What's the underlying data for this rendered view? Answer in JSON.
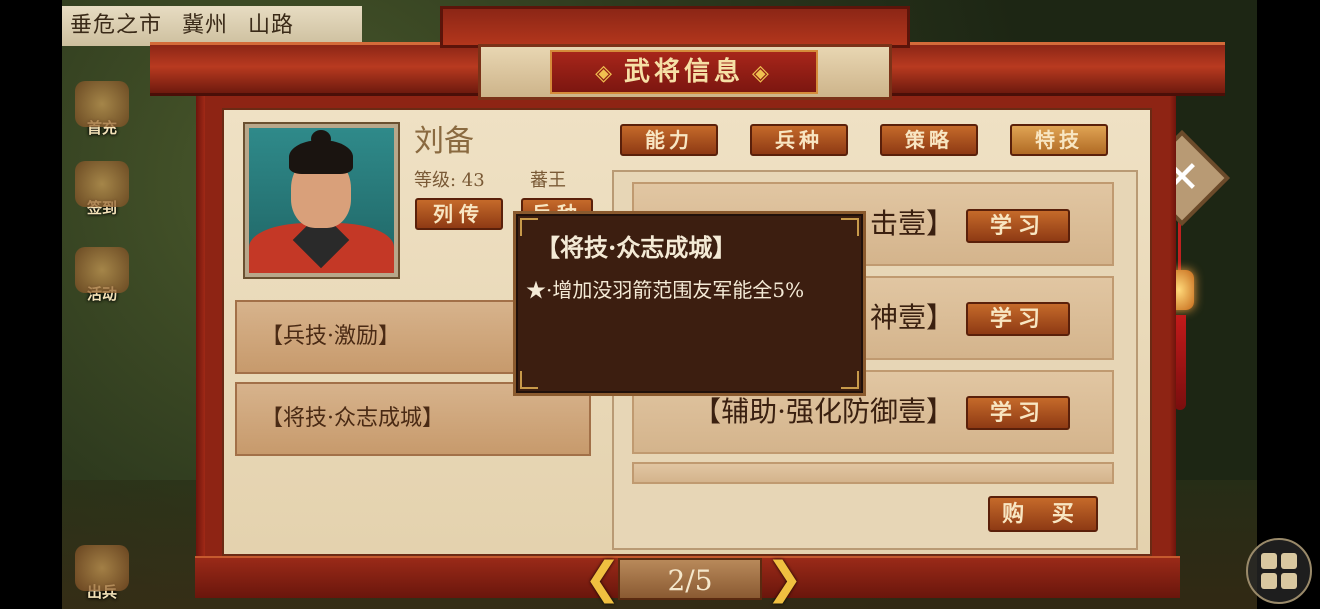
{
  "location": {
    "parts": [
      "垂危之市",
      "冀州",
      "山路"
    ]
  },
  "side_menu": [
    {
      "label": "首充",
      "icon": "treasure-chest-icon"
    },
    {
      "label": "签到",
      "icon": "scroll-brush-icon"
    },
    {
      "label": "活动",
      "icon": "event-icon"
    },
    {
      "label": "出兵",
      "icon": "war-drum-icon"
    }
  ],
  "dialog": {
    "title": "武将信息"
  },
  "hero": {
    "name": "刘备",
    "level": "等级: 43",
    "rank": "蕃王",
    "biography_button": "列传",
    "second_button": "兵种"
  },
  "equipped_skills": [
    "【兵技·激励】",
    "【将技·众志成城】"
  ],
  "tabs": [
    "能力",
    "兵种",
    "策略",
    "特技"
  ],
  "skill_list": [
    {
      "name": "击壹】",
      "action": "学习"
    },
    {
      "name": "神壹】",
      "action": "学习"
    },
    {
      "name": "【辅助·强化防御壹】",
      "action": "学习"
    }
  ],
  "buy_button": "购 买",
  "tooltip": {
    "title": "【将技·众志成城】",
    "description": "★·增加没羽箭范围友军能全5%"
  },
  "pager": {
    "text": "2/5",
    "prev": "❮",
    "next": "❯"
  },
  "close_symbol": "✕",
  "colors": {
    "frame_red": "#8e2414",
    "panel_cream": "#efe1c4",
    "button_brown": "#c56a2a",
    "tooltip_bg": "#3c1e10"
  }
}
